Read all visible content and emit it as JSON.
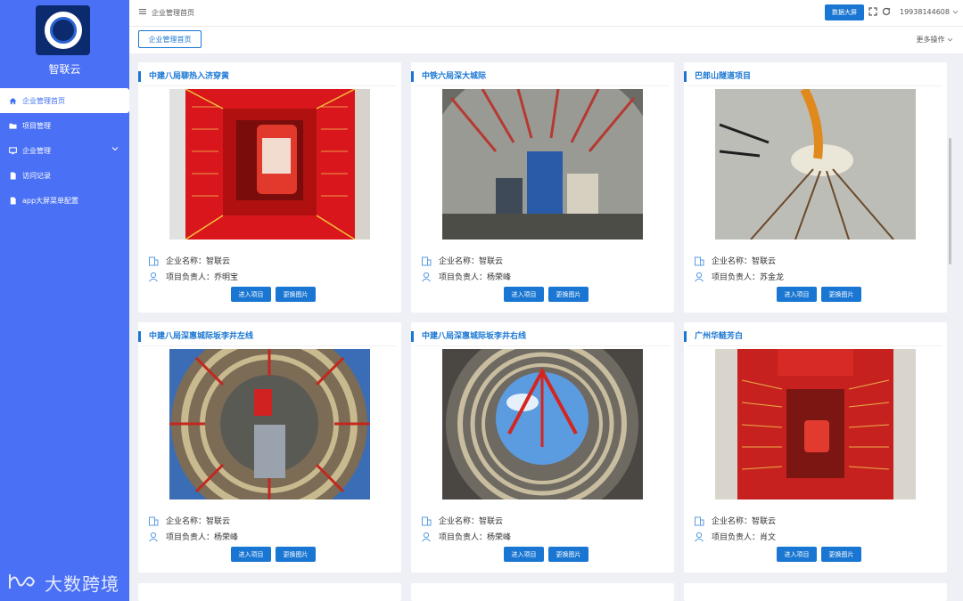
{
  "sidebar": {
    "brand": "智联云",
    "items": [
      {
        "label": "企业管理首页",
        "icon": "home-icon"
      },
      {
        "label": "项目管理",
        "icon": "folder-icon"
      },
      {
        "label": "企业管理",
        "icon": "monitor-icon"
      },
      {
        "label": "访问记录",
        "icon": "document-icon"
      },
      {
        "label": "app大屏菜单配置",
        "icon": "document-icon"
      }
    ],
    "watermark": "大数跨境"
  },
  "header": {
    "breadcrumb": "企业管理首页",
    "big_screen_label": "数据大屏",
    "username": "19938144608"
  },
  "tabs": {
    "active_tab": "企业管理首页",
    "more_ops": "更多操作"
  },
  "card_labels": {
    "company_label": "企业名称：",
    "manager_label": "项目负责人：",
    "enter_button": "进入项目",
    "change_photo_button": "更换图片"
  },
  "projects": [
    {
      "title": "中建八局聊热入济穿黄",
      "company": "智联云",
      "manager": "乔明宝",
      "photo": "red-shaft-photo"
    },
    {
      "title": "中铁六局深大城际",
      "company": "智联云",
      "manager": "杨荣峰",
      "photo": "tbm-tunnel-photo"
    },
    {
      "title": "巴郎山隧道项目",
      "company": "智联云",
      "manager": "苏金龙",
      "photo": "rail-tunnel-photo"
    },
    {
      "title": "中建八局深惠城际坂李井左线",
      "company": "智联云",
      "manager": "杨荣峰",
      "photo": "ring-shaft-photo"
    },
    {
      "title": "中建八局深惠城际坂李井右线",
      "company": "智联云",
      "manager": "杨荣峰",
      "photo": "sky-shaft-photo"
    },
    {
      "title": "广州华鲢芳白",
      "company": "智联云",
      "manager": "肖文",
      "photo": "banner-shaft-photo"
    }
  ]
}
